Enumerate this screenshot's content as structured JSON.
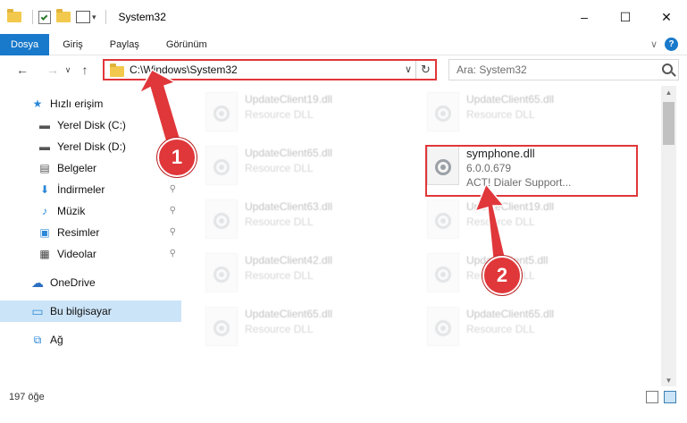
{
  "window": {
    "title": "System32",
    "minimize": "–",
    "maximize": "☐",
    "close": "✕"
  },
  "ribbon": {
    "tabs": [
      {
        "label": "Dosya",
        "active": true
      },
      {
        "label": "Giriş"
      },
      {
        "label": "Paylaş"
      },
      {
        "label": "Görünüm"
      }
    ],
    "expand": "∨",
    "help": "?"
  },
  "nav": {
    "back": "←",
    "forward": "→",
    "recent": "∨",
    "up": "↑",
    "address": "C:\\Windows\\System32",
    "address_dropdown": "∨",
    "refresh": "↻",
    "search_placeholder": "Ara: System32"
  },
  "sidebar": {
    "items": [
      {
        "label": "Hızlı erişim",
        "icon": "star-icon",
        "glyph": "★"
      },
      {
        "label": "Yerel Disk (C:)",
        "icon": "drive-icon",
        "glyph": "▬",
        "pinned": true
      },
      {
        "label": "Yerel Disk (D:)",
        "icon": "drive-icon",
        "glyph": "▬",
        "pinned": true
      },
      {
        "label": "Belgeler",
        "icon": "documents-icon",
        "glyph": "▤",
        "pinned": true
      },
      {
        "label": "İndirmeler",
        "icon": "download-icon",
        "glyph": "⬇",
        "pinned": true
      },
      {
        "label": "Müzik",
        "icon": "music-icon",
        "glyph": "♪",
        "pinned": true
      },
      {
        "label": "Resimler",
        "icon": "pictures-icon",
        "glyph": "▣",
        "pinned": true
      },
      {
        "label": "Videolar",
        "icon": "video-icon",
        "glyph": "▦",
        "pinned": true
      },
      {
        "label": "OneDrive",
        "icon": "cloud-icon",
        "glyph": "☁"
      },
      {
        "label": "Bu bilgisayar",
        "icon": "computer-icon",
        "glyph": "▭",
        "selected": true
      },
      {
        "label": "Ağ",
        "icon": "network-icon",
        "glyph": "⧉"
      }
    ],
    "pin_glyph": "⚲"
  },
  "files": [
    {
      "name": "UpdateClient19.dll",
      "sub": "Resource DLL",
      "faded": true
    },
    {
      "name": "UpdateClient65.dll",
      "sub": "Resource DLL",
      "faded": true
    },
    {
      "name": "UpdateClient65.dll",
      "sub": "Resource DLL",
      "faded": true
    },
    {
      "name": "symphone.dll",
      "version": "6.0.0.679",
      "sub": "ACT! Dialer Support...",
      "faded": false
    },
    {
      "name": "UpdateClient63.dll",
      "sub": "Resource DLL",
      "faded": true
    },
    {
      "name": "UpdateClient19.dll",
      "sub": "Resource DLL",
      "faded": true
    },
    {
      "name": "UpdateClient42.dll",
      "sub": "Resource DLL",
      "faded": true
    },
    {
      "name": "UpdateClient5.dll",
      "sub": "Resource DLL",
      "faded": true
    },
    {
      "name": "UpdateClient65.dll",
      "sub": "Resource DLL",
      "faded": true
    },
    {
      "name": "UpdateClient65.dll",
      "sub": "Resource DLL",
      "faded": true
    }
  ],
  "status": {
    "count": "197 öğe"
  },
  "annotations": {
    "step1": "1",
    "step2": "2",
    "color": "#e0373a"
  }
}
